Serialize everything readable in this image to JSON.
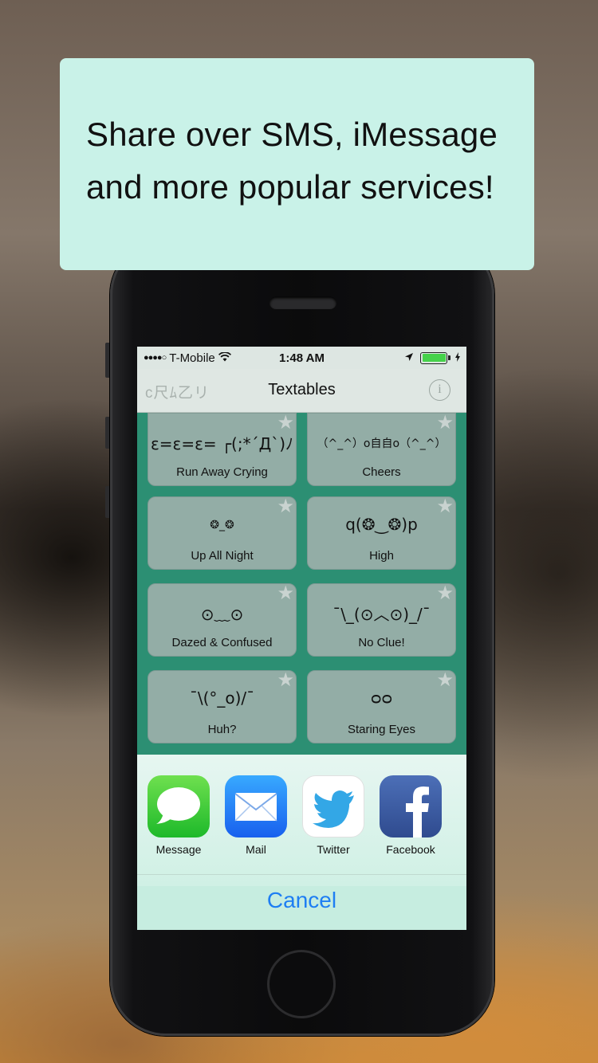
{
  "banner": {
    "line1": "Share over SMS, iMessage",
    "line2": "and more popular services!"
  },
  "statusbar": {
    "dots": "●●●●○",
    "carrier": "T-Mobile",
    "time": "1:48 AM"
  },
  "navbar": {
    "logo": "c尺ﾑ乙リ",
    "title": "Textables",
    "info": "i"
  },
  "cards": [
    {
      "face": "ε=ε=ε= ┌(;*´Д`)ﾉ",
      "label": "Run Away Crying"
    },
    {
      "face": "（^_^）o自自o（^_^）",
      "label": "Cheers"
    },
    {
      "face": "❂_❂",
      "label": "Up All Night"
    },
    {
      "face": "q(❂‿❂)p",
      "label": "High"
    },
    {
      "face": "⊙﹏⊙",
      "label": "Dazed & Confused"
    },
    {
      "face": "¯\\_(⊙︿⊙)_/¯",
      "label": "No Clue!"
    },
    {
      "face": "¯\\(°_o)/¯",
      "label": "Huh?"
    },
    {
      "face": "ᴑᴑ",
      "label": "Staring Eyes"
    }
  ],
  "share": [
    {
      "name": "Message",
      "icon": "message-icon"
    },
    {
      "name": "Mail",
      "icon": "mail-icon"
    },
    {
      "name": "Twitter",
      "icon": "twitter-icon"
    },
    {
      "name": "Facebook",
      "icon": "facebook-icon"
    }
  ],
  "cancel_label": "Cancel",
  "colors": {
    "banner": "#c9f2e8",
    "grid_bg": "#2c8f73",
    "card": "#93ada6",
    "cancel": "#1e7ef3",
    "battery": "#45d24a"
  }
}
